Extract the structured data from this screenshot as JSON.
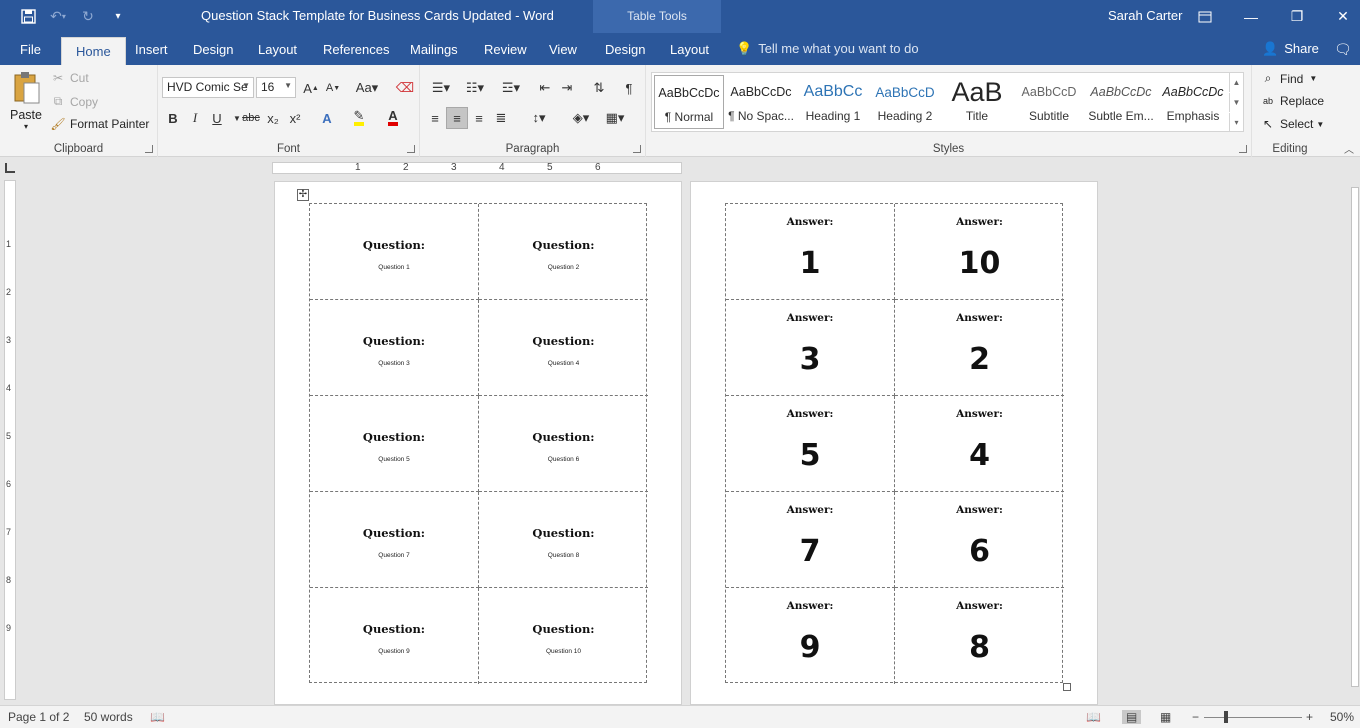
{
  "title_bar": {
    "doc_title": "Question Stack Template for Business Cards Updated  -  Word",
    "context_label": "Table Tools",
    "user": "Sarah Carter",
    "save_icon": "save-icon",
    "undo_icon": "undo-icon",
    "redo_icon": "redo-icon",
    "customize_icon": "customize-qat-icon"
  },
  "tabs": [
    "File",
    "Home",
    "Insert",
    "Design",
    "Layout",
    "References",
    "Mailings",
    "Review",
    "View",
    "Design",
    "Layout"
  ],
  "active_tab": "Home",
  "tell_me": "Tell me what you want to do",
  "share": "Share",
  "clipboard": {
    "paste": "Paste",
    "cut": "Cut",
    "copy": "Copy",
    "format_painter": "Format Painter",
    "label": "Clipboard"
  },
  "font": {
    "name": "HVD Comic Se",
    "size": "16",
    "label": "Font",
    "bold": "B",
    "italic": "I",
    "underline": "U",
    "strike": "abc",
    "sub": "x₂",
    "sup": "x²"
  },
  "paragraph": {
    "label": "Paragraph"
  },
  "styles": {
    "label": "Styles",
    "items": [
      {
        "sample": "AaBbCcDc",
        "name": "¶ Normal"
      },
      {
        "sample": "AaBbCcDc",
        "name": "¶ No Spac..."
      },
      {
        "sample": "AaBbCc",
        "name": "Heading 1"
      },
      {
        "sample": "AaBbCcD",
        "name": "Heading 2"
      },
      {
        "sample": "AaB",
        "name": "Title"
      },
      {
        "sample": "AaBbCcD",
        "name": "Subtitle"
      },
      {
        "sample": "AaBbCcDc",
        "name": "Subtle Em..."
      },
      {
        "sample": "AaBbCcDc",
        "name": "Emphasis"
      }
    ]
  },
  "editing": {
    "label": "Editing",
    "find": "Find",
    "replace": "Replace",
    "select": "Select"
  },
  "ruler": {
    "h_numbers": [
      "1",
      "2",
      "3",
      "4",
      "5",
      "6"
    ],
    "v_numbers": [
      "1",
      "2",
      "3",
      "4",
      "5",
      "6",
      "7",
      "8",
      "9"
    ]
  },
  "questions": {
    "label": "Question:",
    "items": [
      "Question 1",
      "Question 2",
      "Question 3",
      "Question 4",
      "Question 5",
      "Question 6",
      "Question 7",
      "Question 8",
      "Question 9",
      "Question 10"
    ]
  },
  "answers": {
    "label": "Answer:",
    "values": [
      "1",
      "10",
      "3",
      "2",
      "5",
      "4",
      "7",
      "6",
      "9",
      "8"
    ]
  },
  "status": {
    "page": "Page 1 of 2",
    "words": "50 words",
    "zoom": "50%"
  }
}
